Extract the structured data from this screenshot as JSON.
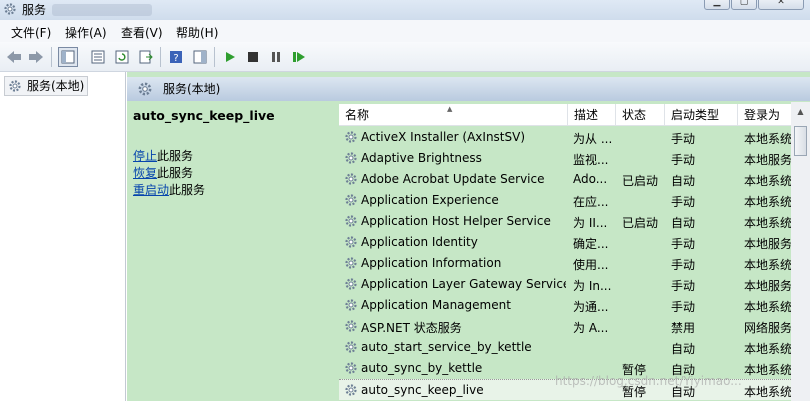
{
  "window": {
    "title": "服务"
  },
  "menu": [
    {
      "label": "文件(F)"
    },
    {
      "label": "操作(A)"
    },
    {
      "label": "查看(V)"
    },
    {
      "label": "帮助(H)"
    }
  ],
  "tree": {
    "root_label": "服务(本地)"
  },
  "header": {
    "title": "服务(本地)"
  },
  "selected_service": {
    "name": "auto_sync_keep_live",
    "actions": [
      {
        "link": "停止",
        "suffix": "此服务"
      },
      {
        "link": "恢复",
        "suffix": "此服务"
      },
      {
        "link": "重启动",
        "suffix": "此服务"
      }
    ]
  },
  "columns": {
    "name": "名称",
    "description": "描述",
    "status": "状态",
    "startup": "启动类型",
    "logon": "登录为"
  },
  "rows": [
    {
      "name": "ActiveX Installer (AxInstSV)",
      "desc": "为从 ...",
      "status": "",
      "startup": "手动",
      "logon": "本地系统"
    },
    {
      "name": "Adaptive Brightness",
      "desc": "监视...",
      "status": "",
      "startup": "手动",
      "logon": "本地服务"
    },
    {
      "name": "Adobe Acrobat Update Service",
      "desc": "Ado...",
      "status": "已启动",
      "startup": "自动",
      "logon": "本地系统"
    },
    {
      "name": "Application Experience",
      "desc": "在应...",
      "status": "",
      "startup": "手动",
      "logon": "本地系统"
    },
    {
      "name": "Application Host Helper Service",
      "desc": "为 II...",
      "status": "已启动",
      "startup": "自动",
      "logon": "本地系统"
    },
    {
      "name": "Application Identity",
      "desc": "确定...",
      "status": "",
      "startup": "手动",
      "logon": "本地服务"
    },
    {
      "name": "Application Information",
      "desc": "使用...",
      "status": "",
      "startup": "手动",
      "logon": "本地系统"
    },
    {
      "name": "Application Layer Gateway Service",
      "desc": "为 In...",
      "status": "",
      "startup": "手动",
      "logon": "本地服务"
    },
    {
      "name": "Application Management",
      "desc": "为通...",
      "status": "",
      "startup": "手动",
      "logon": "本地系统"
    },
    {
      "name": "ASP.NET 状态服务",
      "desc": "为 A...",
      "status": "",
      "startup": "禁用",
      "logon": "网络服务"
    },
    {
      "name": "auto_start_service_by_kettle",
      "desc": "",
      "status": "",
      "startup": "自动",
      "logon": "本地系统"
    },
    {
      "name": "auto_sync_by_kettle",
      "desc": "",
      "status": "暂停",
      "startup": "自动",
      "logon": "本地系统"
    },
    {
      "name": "auto_sync_keep_live",
      "desc": "",
      "status": "暂停",
      "startup": "自动",
      "logon": "本地系统"
    }
  ],
  "watermark": "https://blog.csdn.net/Yiyimao..."
}
